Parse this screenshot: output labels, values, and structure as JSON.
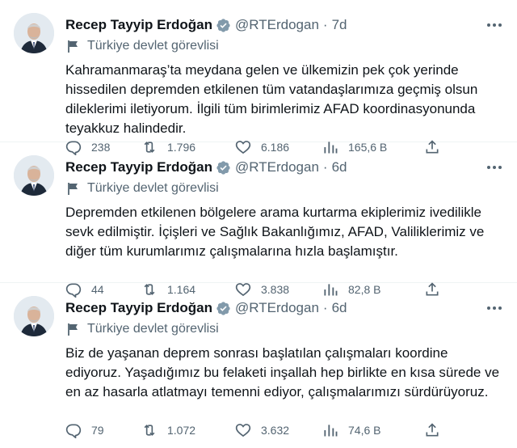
{
  "tweets": [
    {
      "author_name": "Recep Tayyip Erdoğan",
      "handle": "@RTErdogan",
      "separator": "·",
      "time": "7d",
      "label": "Türkiye devlet görevlisi",
      "text": "Kahramanmaraş’ta meydana gelen ve ülkemizin pek çok yerinde hissedilen depremden etkilenen tüm vatandaşlarımıza geçmiş olsun dileklerimi iletiyorum. İlgili tüm birimlerimiz AFAD koordinasyonunda teyakkuz halindedir.",
      "replies": "238",
      "retweets": "1.796",
      "likes": "6.186",
      "views": "165,6 B"
    },
    {
      "author_name": "Recep Tayyip Erdoğan",
      "handle": "@RTErdogan",
      "separator": "·",
      "time": "6d",
      "label": "Türkiye devlet görevlisi",
      "text": "Depremden etkilenen bölgelere arama kurtarma ekiplerimiz ivedilikle sevk edilmiştir. İçişleri ve Sağlık Bakanlığımız, AFAD, Valiliklerimiz ve diğer tüm kurumlarımız çalışmalarına hızla başlamıştır.",
      "replies": "44",
      "retweets": "1.164",
      "likes": "3.838",
      "views": "82,8 B"
    },
    {
      "author_name": "Recep Tayyip Erdoğan",
      "handle": "@RTErdogan",
      "separator": "·",
      "time": "6d",
      "label": "Türkiye devlet görevlisi",
      "text": "Biz de yaşanan deprem sonrası başlatılan çalışmaları koordine ediyoruz. Yaşadığımız bu felaketi inşallah hep birlikte en kısa sürede ve en az hasarla atlatmayı temenni ediyor, çalışmalarımızı sürdürüyoruz.",
      "replies": "79",
      "retweets": "1.072",
      "likes": "3.632",
      "views": "74,6 B"
    }
  ],
  "colors": {
    "text": "#0f1419",
    "secondary": "#536471",
    "verified_badge": "#829aab",
    "border": "#eff3f4"
  },
  "icons": {
    "reply": "reply-icon",
    "retweet": "retweet-icon",
    "like": "like-icon",
    "views": "views-icon",
    "share": "share-icon",
    "more": "more-icon",
    "verified": "verified-badge-icon",
    "label": "flag-icon"
  }
}
